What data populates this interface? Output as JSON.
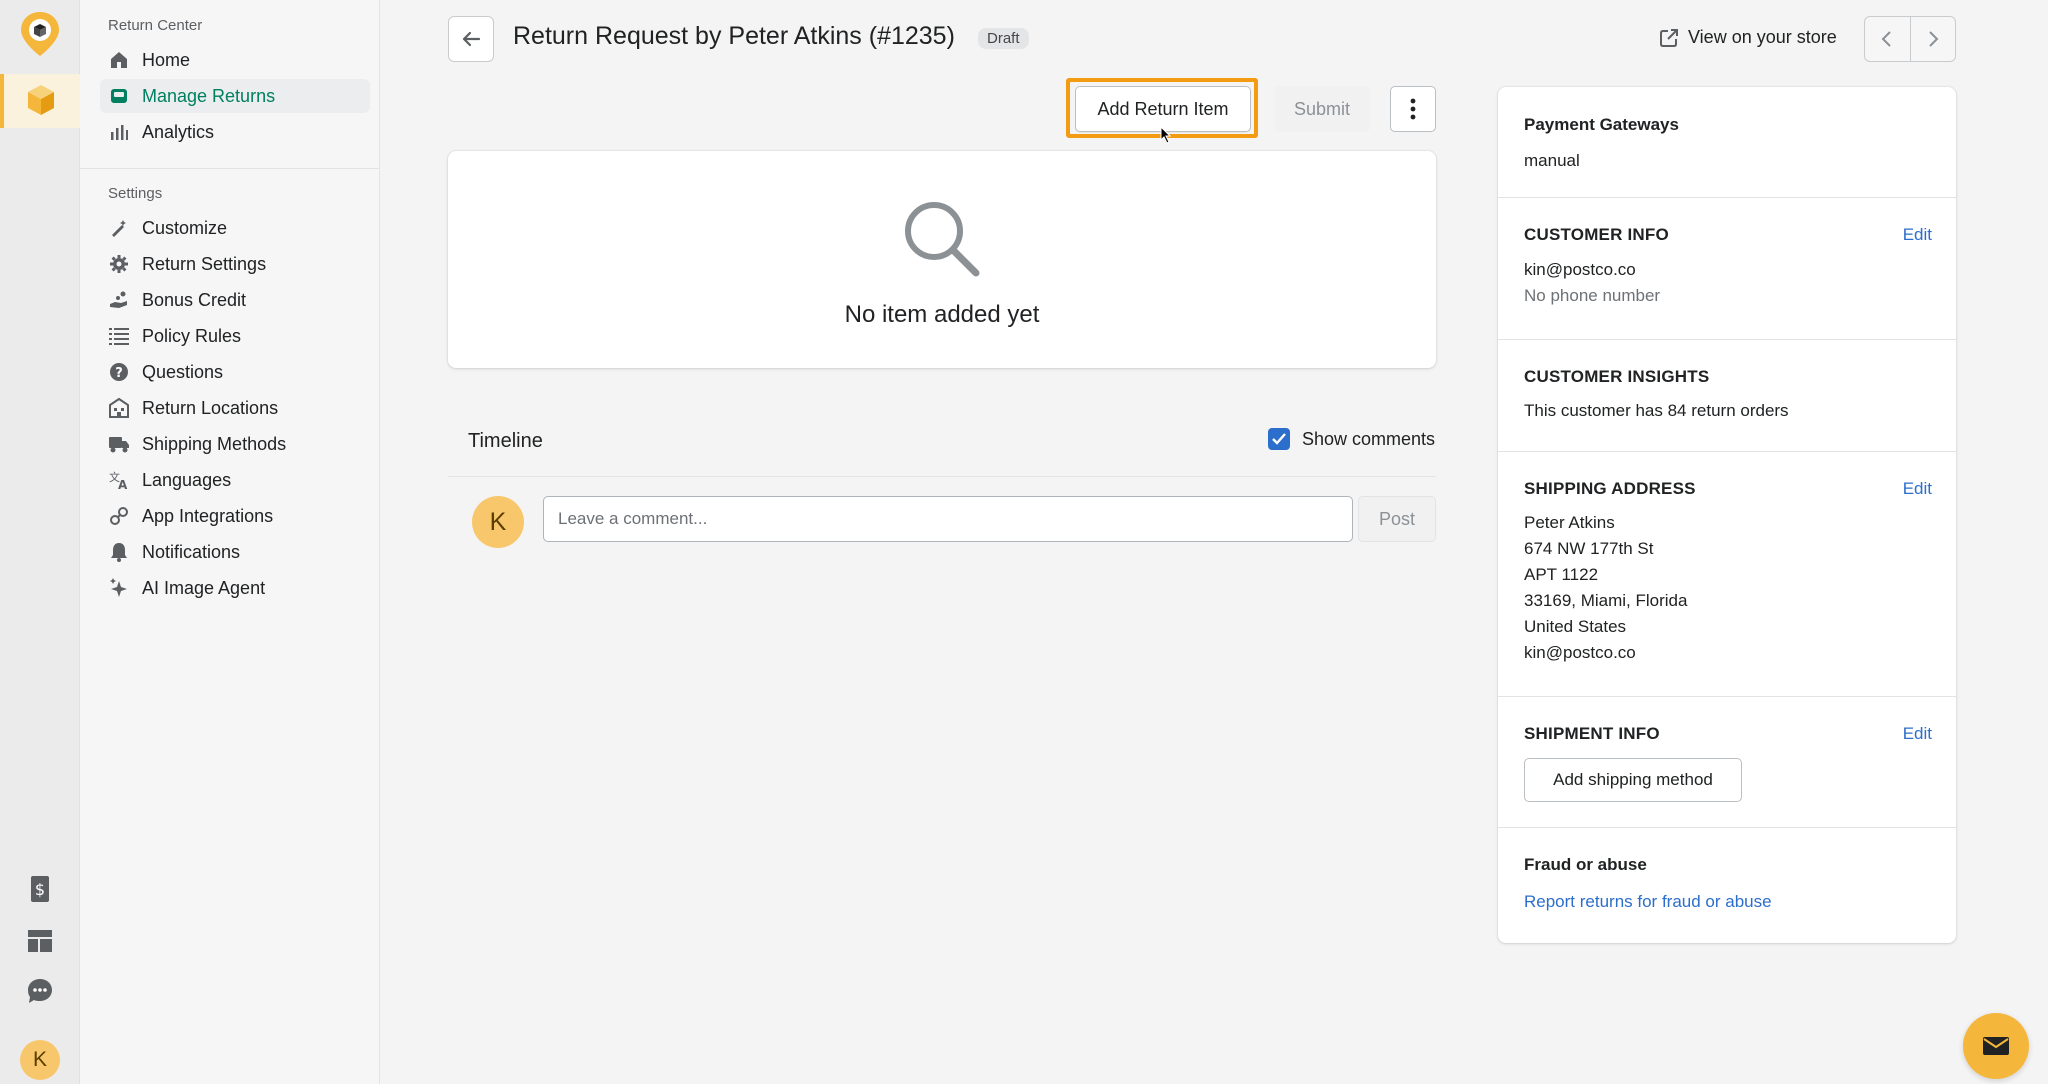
{
  "nav": {
    "section_main": "Return Center",
    "main_items": [
      {
        "label": "Home"
      },
      {
        "label": "Manage Returns"
      },
      {
        "label": "Analytics"
      }
    ],
    "section_settings": "Settings",
    "settings_items": [
      {
        "label": "Customize"
      },
      {
        "label": "Return Settings"
      },
      {
        "label": "Bonus Credit"
      },
      {
        "label": "Policy Rules"
      },
      {
        "label": "Questions"
      },
      {
        "label": "Return Locations"
      },
      {
        "label": "Shipping Methods"
      },
      {
        "label": "Languages"
      },
      {
        "label": "App Integrations"
      },
      {
        "label": "Notifications"
      },
      {
        "label": "AI Image Agent"
      }
    ],
    "user_initial": "K"
  },
  "header": {
    "title": "Return Request by Peter Atkins (#1235)",
    "badge": "Draft",
    "view_store": "View on your store"
  },
  "actions": {
    "add_return_item": "Add Return Item",
    "submit": "Submit"
  },
  "empty_state": {
    "text": "No item added yet"
  },
  "timeline": {
    "title": "Timeline",
    "show_comments": "Show comments",
    "avatar_initial": "K",
    "comment_placeholder": "Leave a comment...",
    "post": "Post"
  },
  "panel": {
    "payment": {
      "title": "Payment Gateways",
      "value": "manual"
    },
    "customer": {
      "title": "CUSTOMER INFO",
      "edit": "Edit",
      "email": "kin@postco.co",
      "phone": "No phone number"
    },
    "insights": {
      "title": "CUSTOMER INSIGHTS",
      "text": "This customer has 84 return orders"
    },
    "shipping": {
      "title": "SHIPPING ADDRESS",
      "edit": "Edit",
      "lines": [
        "Peter Atkins",
        "674 NW 177th St",
        "APT 1122",
        "33169, Miami, Florida",
        "United States",
        "kin@postco.co"
      ]
    },
    "shipment": {
      "title": "SHIPMENT INFO",
      "edit": "Edit",
      "button": "Add shipping method"
    },
    "fraud": {
      "title": "Fraud or abuse",
      "link": "Report returns for fraud or abuse"
    }
  },
  "colors": {
    "accent": "#f5b73b",
    "highlight": "#f39c12",
    "active_nav": "#008060",
    "link": "#2c6ecb"
  }
}
